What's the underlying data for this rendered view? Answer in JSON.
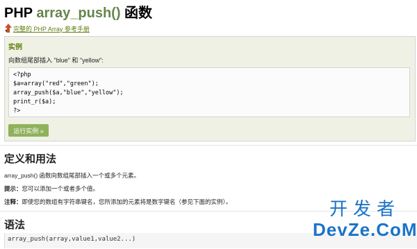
{
  "page": {
    "title_prefix": "PHP ",
    "title_function": "array_push()",
    "title_suffix": " 函数"
  },
  "reference_link": "完整的 PHP Array 参考手册",
  "example": {
    "heading": "实例",
    "description": "向数组尾部插入 \"blue\" 和 \"yellow\":",
    "code_lines": [
      "<?php",
      "$a=array(\"red\",\"green\");",
      "array_push($a,\"blue\",\"yellow\");",
      "print_r($a);",
      "?>"
    ],
    "run_button": "运行实例 »"
  },
  "definition": {
    "heading": "定义和用法",
    "text": "array_push() 函数向数组尾部插入一个或多个元素。",
    "tip_label": "提示：",
    "tip_text": "您可以添加一个或者多个值。",
    "note_label": "注释：",
    "note_text": "即使您的数组有字符串键名，您所添加的元素将是数字键名（参见下面的实例）。"
  },
  "syntax": {
    "heading": "语法",
    "code": "array_push(array,value1,value2...)"
  },
  "watermark": {
    "line1": "开发者",
    "line2": "DevZe.CoM"
  },
  "colors": {
    "function_name": "#64854c",
    "link": "#617f10",
    "example_bg": "#eef1e4",
    "run_button_bg": "#8fb15c",
    "watermark": "#1a73c8"
  },
  "icons": {
    "reference_arrow": "up-arrow-icon"
  }
}
